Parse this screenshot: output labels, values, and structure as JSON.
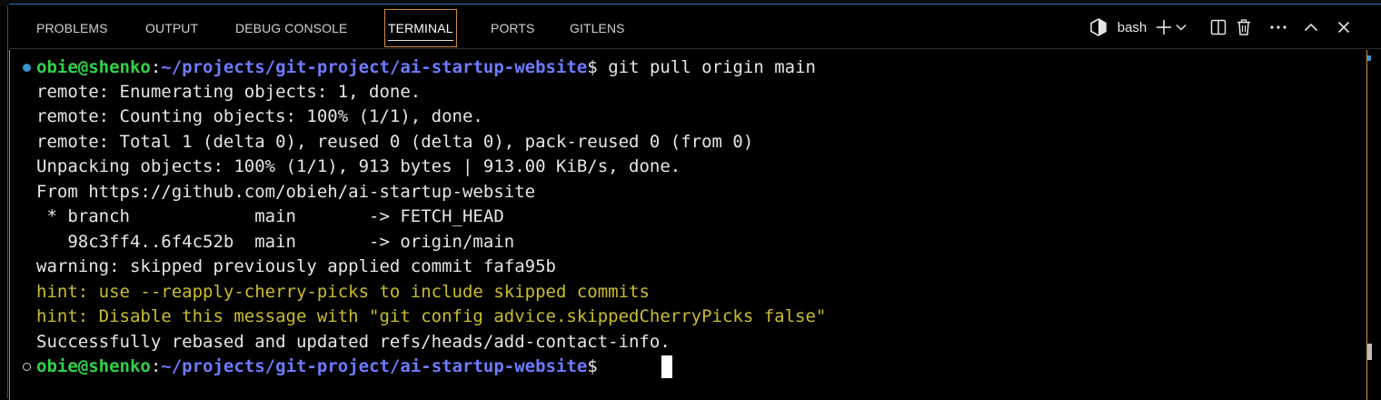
{
  "tabs": [
    {
      "label": "PROBLEMS",
      "active": false
    },
    {
      "label": "OUTPUT",
      "active": false
    },
    {
      "label": "DEBUG CONSOLE",
      "active": false
    },
    {
      "label": "TERMINAL",
      "active": true
    },
    {
      "label": "PORTS",
      "active": false
    },
    {
      "label": "GITLENS",
      "active": false
    }
  ],
  "actions": {
    "shell_name": "bash",
    "icons": [
      "terminal-profile-icon",
      "add-terminal-icon",
      "chevron-down-icon",
      "split-terminal-icon",
      "trash-icon",
      "more-actions-icon",
      "maximize-panel-icon",
      "close-panel-icon"
    ]
  },
  "terminal": {
    "prompt_1": {
      "user": "obie@shenko",
      "separator": ":",
      "path": "~/projects/git-project/ai-startup-website",
      "sign": "$ ",
      "command": "git pull origin main"
    },
    "output": [
      {
        "text": "remote: Enumerating objects: 1, done.",
        "kind": "normal"
      },
      {
        "text": "remote: Counting objects: 100% (1/1), done.",
        "kind": "normal"
      },
      {
        "text": "remote: Total 1 (delta 0), reused 0 (delta 0), pack-reused 0 (from 0)",
        "kind": "normal"
      },
      {
        "text": "Unpacking objects: 100% (1/1), 913 bytes | 913.00 KiB/s, done.",
        "kind": "normal"
      },
      {
        "text": "From https://github.com/obieh/ai-startup-website",
        "kind": "normal"
      },
      {
        "text": " * branch            main       -> FETCH_HEAD",
        "kind": "normal"
      },
      {
        "text": "   98c3ff4..6f4c52b  main       -> origin/main",
        "kind": "normal"
      },
      {
        "text": "warning: skipped previously applied commit fafa95b",
        "kind": "normal"
      },
      {
        "text": "hint: use --reapply-cherry-picks to include skipped commits",
        "kind": "hint"
      },
      {
        "text": "hint: Disable this message with \"git config advice.skippedCherryPicks false\"",
        "kind": "hint"
      },
      {
        "text": "Successfully rebased and updated refs/heads/add-contact-info.",
        "kind": "normal"
      }
    ],
    "prompt_2": {
      "user": "obie@shenko",
      "separator": ":",
      "path": "~/projects/git-project/ai-startup-website",
      "sign": "$ ",
      "command": ""
    }
  },
  "colors": {
    "accent": "#d18a3c",
    "prompt_user": "#2fd24a",
    "prompt_path": "#6d7bff",
    "hint": "#cbbd2c",
    "decoration_success": "#3794c9"
  }
}
